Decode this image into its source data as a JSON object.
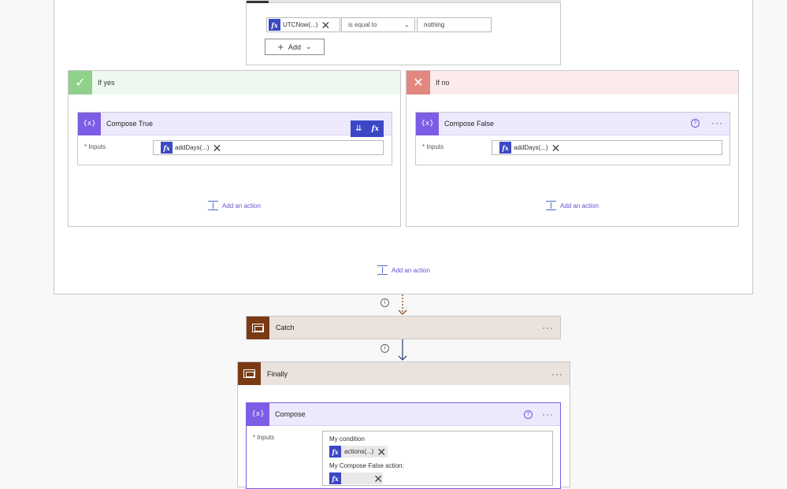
{
  "condition": {
    "left_token": "UTCNow(...)",
    "operator": "is equal to",
    "right_value": "nothing",
    "add_label": "Add"
  },
  "if_yes": {
    "title": "If yes",
    "action_title": "Compose True",
    "inputs_label": "* Inputs",
    "input_token": "addDays(...)",
    "add_action": "Add an action"
  },
  "if_no": {
    "title": "If no",
    "action_title": "Compose False",
    "inputs_label": "* Inputs",
    "input_token": "addDays(...)",
    "add_action": "Add an action"
  },
  "scope": {
    "add_action": "Add an action"
  },
  "catch": {
    "title": "Catch"
  },
  "finally": {
    "title": "Finally",
    "compose": {
      "title": "Compose",
      "inputs_label": "* Inputs",
      "line1": "My condition",
      "token1": "actions(...)",
      "line2": "My Compose False action:"
    }
  },
  "icons": {
    "fx": "fx",
    "compose": "{x}",
    "help": "?",
    "info": "i",
    "more": "···"
  },
  "colors": {
    "accent": "#3b47c4",
    "compose_purple": "#7d5ce6",
    "yes_green": "#8fd18a",
    "no_red": "#e0877f",
    "scope_brown": "#7a3b14",
    "link": "#6b4fd3"
  }
}
